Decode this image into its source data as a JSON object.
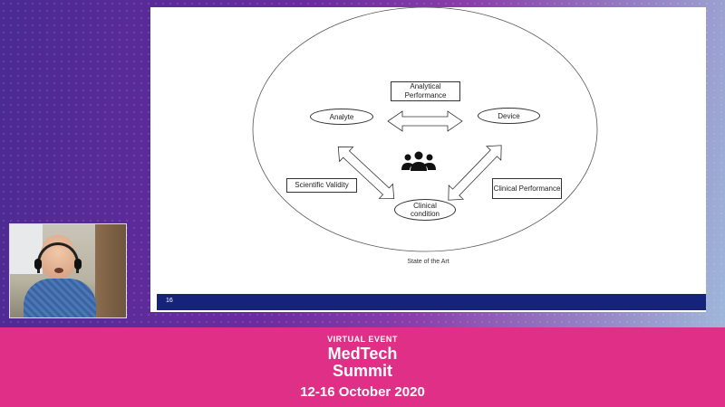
{
  "slide": {
    "boxes": {
      "analytical_performance": "Analytical Performance",
      "scientific_validity": "Scientific Validity",
      "clinical_performance": "Clinical Performance"
    },
    "ellipses": {
      "analyte": "Analyte",
      "device": "Device",
      "clinical_condition": "Clinical condition"
    },
    "center_icon": "group-people-icon",
    "caption": "State of the Art",
    "page_number": "16"
  },
  "banner": {
    "event_label": "VIRTUAL EVENT",
    "title_line1": "MedTech",
    "title_line2": "Summit",
    "dates": "12-16 October 2020"
  },
  "colors": {
    "banner_pink": "#e02f86",
    "slide_footer_blue": "#16237a"
  }
}
